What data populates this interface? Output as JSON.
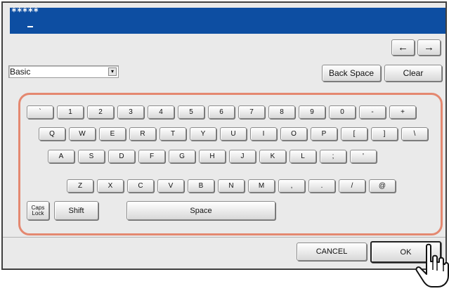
{
  "input": {
    "masked_value": "*****"
  },
  "dropdown": {
    "selected": "Basic"
  },
  "buttons": {
    "cursor_left_icon": "arrow-left",
    "cursor_right_icon": "arrow-right",
    "back_space": "Back Space",
    "clear": "Clear",
    "cancel": "CANCEL",
    "ok": "OK"
  },
  "keyboard": {
    "rows": [
      [
        "`",
        "1",
        "2",
        "3",
        "4",
        "5",
        "6",
        "7",
        "8",
        "9",
        "0",
        "-",
        "+"
      ],
      [
        "Q",
        "W",
        "E",
        "R",
        "T",
        "Y",
        "U",
        "I",
        "O",
        "P",
        "[",
        "]",
        "\\"
      ],
      [
        "A",
        "S",
        "D",
        "F",
        "G",
        "H",
        "J",
        "K",
        "L",
        ";",
        "'"
      ],
      [
        "Z",
        "X",
        "C",
        "V",
        "B",
        "N",
        "M",
        ",",
        ".",
        "/",
        "@"
      ]
    ],
    "caps_lock_line1": "Caps",
    "caps_lock_line2": "Lock",
    "shift": "Shift",
    "space": "Space"
  },
  "colors": {
    "titlebar": "#0d4ea2",
    "keyboard_outline": "#e48870",
    "panel_background": "#eaeaea"
  }
}
